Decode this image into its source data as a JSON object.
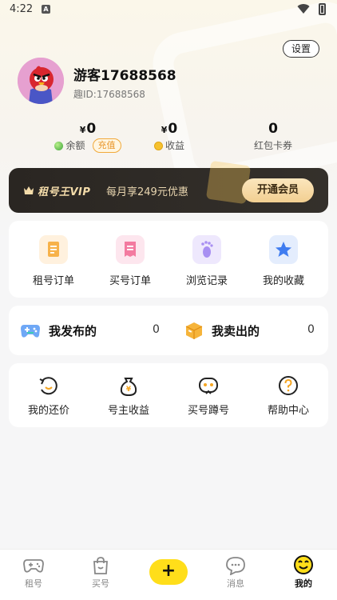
{
  "status_bar": {
    "time": "4:22",
    "notif_letter": "A"
  },
  "header": {
    "settings_label": "设置"
  },
  "profile": {
    "name": "游客17688568",
    "id_text": "趣ID:17688568"
  },
  "stats": [
    {
      "currency": "¥",
      "value": "0",
      "label": "余额",
      "action": "充值"
    },
    {
      "currency": "¥",
      "value": "0",
      "label": "收益"
    },
    {
      "currency": "",
      "value": "0",
      "label": "红包卡券"
    }
  ],
  "vip": {
    "logo": "租号王VIP",
    "promo": "每月享249元优惠",
    "button": "开通会员"
  },
  "orders": [
    {
      "label": "租号订单",
      "icon": "document-icon",
      "color": "#f7b24a"
    },
    {
      "label": "买号订单",
      "icon": "receipt-icon",
      "color": "#f37aa0"
    },
    {
      "label": "浏览记录",
      "icon": "footprint-icon",
      "color": "#a88ff2"
    },
    {
      "label": "我的收藏",
      "icon": "star-icon",
      "color": "#3f7cf0"
    }
  ],
  "publish": [
    {
      "label": "我发布的",
      "count": "0",
      "icon": "gamepad-icon"
    },
    {
      "label": "我卖出的",
      "count": "0",
      "icon": "box-icon"
    }
  ],
  "services": [
    {
      "label": "我的还价",
      "icon": "bargain-icon"
    },
    {
      "label": "号主收益",
      "icon": "money-bag-icon"
    },
    {
      "label": "买号蹲号",
      "icon": "watch-icon"
    },
    {
      "label": "帮助中心",
      "icon": "help-icon"
    }
  ],
  "nav": [
    {
      "label": "租号",
      "icon": "gamepad-icon"
    },
    {
      "label": "买号",
      "icon": "bag-icon"
    },
    {
      "label": "+",
      "icon": "plus-icon"
    },
    {
      "label": "消息",
      "icon": "chat-icon"
    },
    {
      "label": "我的",
      "icon": "smile-icon",
      "active": true
    }
  ]
}
